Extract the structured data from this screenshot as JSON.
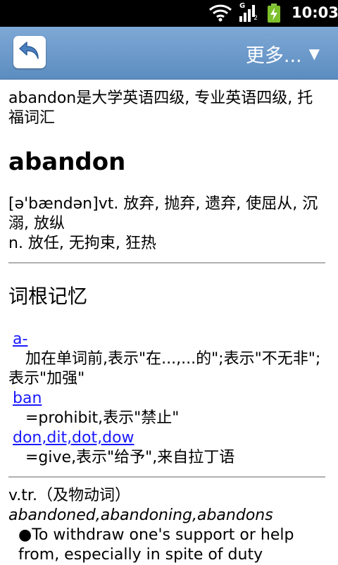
{
  "status_bar": {
    "time": "10:03",
    "network": "G",
    "sim": "2"
  },
  "title_bar": {
    "back_label": "",
    "more_label": "更多...",
    "more_arrow": "▼"
  },
  "entry": {
    "intro": "abandon是大学英语四级, 专业英语四级, 托福词汇",
    "headword": "abandon",
    "pron_line": "[ə'bændən]vt. 放弃, 抛弃, 遗弃, 使屈从, 沉溺, 放纵",
    "noun_line": "n. 放任, 无拘束, 狂热",
    "root_section_title": "词根记忆",
    "roots": [
      {
        "link": "a-",
        "desc": "加在单词前,表示\"在...,...的\";表示\"不无非\";表示\"加强\""
      },
      {
        "link": "ban",
        "desc": "=prohibit,表示\"禁止\""
      },
      {
        "link": "don,dit,dot,dow",
        "desc": "=give,表示\"给予\",来自拉丁语"
      }
    ],
    "pos_label": "v.tr.（及物动词）",
    "forms": "abandoned,abandoning,abandons",
    "definition": "To withdraw one's support or help from, especially in spite of duty"
  }
}
